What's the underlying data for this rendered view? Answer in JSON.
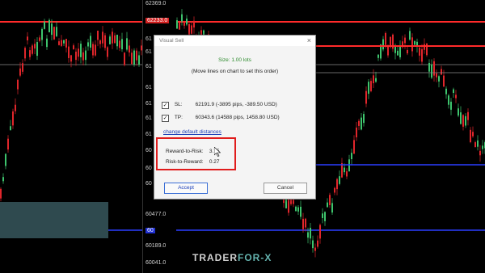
{
  "price_axis": {
    "ticks": [
      "62369.0",
      "62233.0",
      "61",
      "61",
      "61",
      "61",
      "61",
      "61",
      "61",
      "60",
      "60",
      "60",
      "60477.0",
      "60",
      "60189.0",
      "60041.0"
    ]
  },
  "dialog": {
    "title": "Visual Sell",
    "close_label": "×",
    "size_text": "Size: 1.00 lots",
    "hint_text": "(Move lines on chart to set this order)",
    "sl": {
      "label": "SL:",
      "value": "62191.9  (-3895 pips,  -389.50 USD)",
      "checked": true
    },
    "tp": {
      "label": "TP:",
      "value": "60343.6  (14588 pips,  1458.80 USD)",
      "checked": true
    },
    "change_distances_link": "change default distances",
    "reward_to_risk_label": "Reward-to-Risk:",
    "reward_to_risk_value": "3.75",
    "risk_to_reward_label": "Risk-to-Reward:",
    "risk_to_reward_value": "0.27",
    "accept_label": "Accept",
    "cancel_label": "Cancel"
  },
  "watermark": {
    "prefix": "TRADER",
    "suffix": "FOR-X"
  },
  "colors": {
    "bull_candle": "#3ec46d",
    "bear_candle": "#e0262b",
    "sl_line": "#ff2a2a",
    "tp_line": "#2a3dff",
    "accent_box": "#e01c1c",
    "zone_fill": "#2f4a4f"
  }
}
